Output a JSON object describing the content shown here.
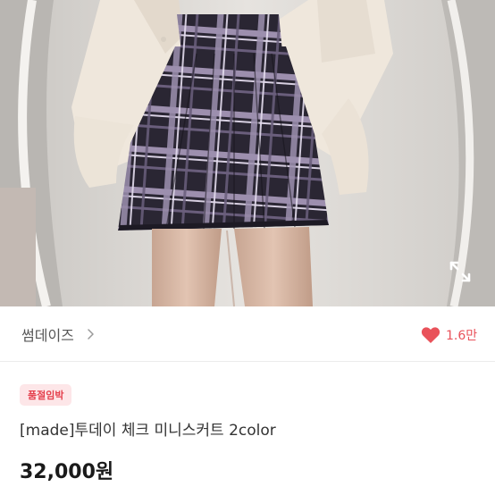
{
  "product": {
    "photo_alt": "plaid pleated mini skirt photo",
    "seller_name": "썸데이즈",
    "like_count": "1.6만",
    "status_badge": "품절임박",
    "title": "[made]투데이 체크 미니스커트 2color",
    "price": "32,000원"
  },
  "colors": {
    "like_accent": "#e9525a",
    "badge_bg": "#fde6e8",
    "badge_text": "#e5404d"
  },
  "icons": {
    "expand": "expand-icon",
    "chevron": "chevron-right-icon",
    "heart": "heart-icon"
  }
}
